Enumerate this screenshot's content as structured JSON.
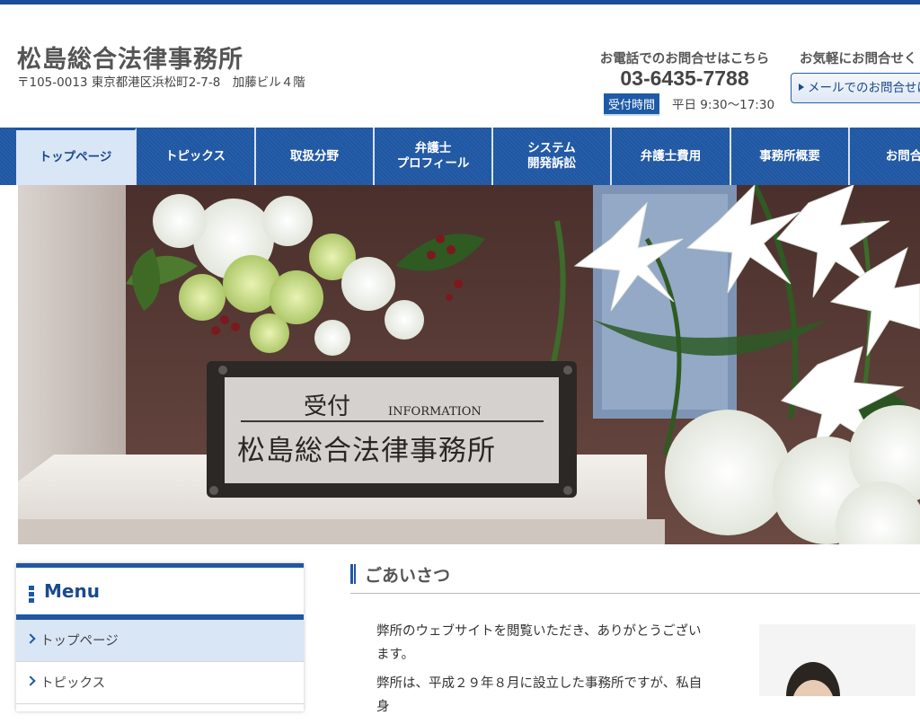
{
  "header": {
    "title": "松島総合法律事務所",
    "address": "〒105-0013 東京都港区浜松町2-7-8　加藤ビル４階",
    "phone_caption": "お電話でのお問合せはこちら",
    "phone_number": "03-6435-7788",
    "hours_label": "受付時間",
    "hours_text": "平日 9:30〜17:30",
    "contact_caption": "お気軽にお問合せく",
    "mail_button": "メールでのお問合せは"
  },
  "nav": {
    "items": [
      {
        "label": "トップページ"
      },
      {
        "label": "トピックス"
      },
      {
        "label": "取扱分野"
      },
      {
        "label": "弁護士\nプロフィール"
      },
      {
        "label": "システム\n開発訴訟"
      },
      {
        "label": "弁護士費用"
      },
      {
        "label": "事務所概要"
      },
      {
        "label": "お問合"
      }
    ]
  },
  "hero": {
    "sign_small": "受付",
    "sign_info": "INFORMATION",
    "sign_main": "松島総合法律事務所"
  },
  "sidebar": {
    "title": "Menu",
    "items": [
      {
        "label": "トップページ"
      },
      {
        "label": "トピックス"
      }
    ]
  },
  "main": {
    "section_title": "ごあいさつ",
    "paragraphs": [
      "弊所のウェブサイトを閲覧いただき、ありがとうございます。",
      "弊所は、平成２９年８月に設立した事務所ですが、私自身"
    ]
  },
  "colors": {
    "accent": "#1f57a3",
    "active_bg": "#d9e6f6"
  }
}
